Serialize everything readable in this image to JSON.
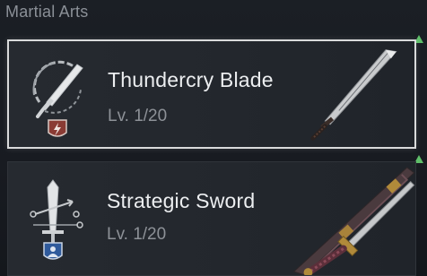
{
  "section": {
    "title": "Martial Arts"
  },
  "arts": [
    {
      "name": "Thundercry Blade",
      "level": "Lv. 1/20",
      "selected": true,
      "icon": "blade-skill-icon",
      "badge_color": "#8a3b34"
    },
    {
      "name": "Strategic Sword",
      "level": "Lv. 1/20",
      "selected": false,
      "icon": "sword-skill-icon",
      "badge_color": "#2f5a9c"
    }
  ],
  "colors": {
    "selected_border": "#d9dadb",
    "scroll_marker": "#5fbf6a"
  }
}
